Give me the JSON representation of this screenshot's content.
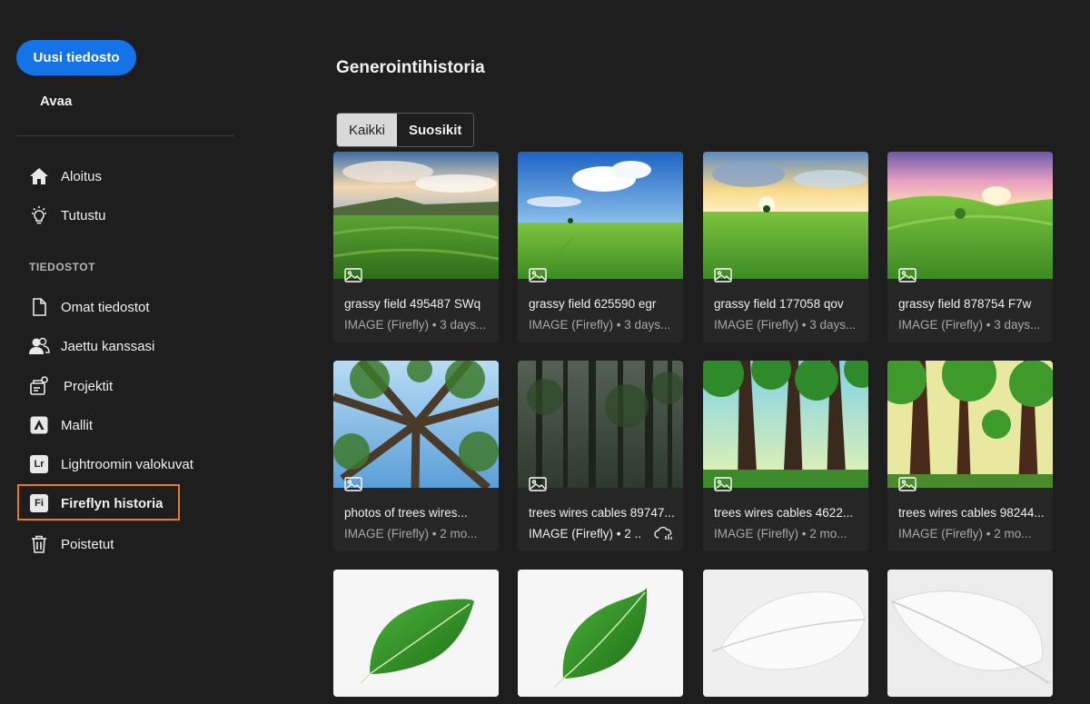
{
  "sidebar": {
    "new_file": "Uusi tiedosto",
    "open": "Avaa",
    "nav_top": [
      {
        "label": "Aloitus",
        "icon": "home-icon"
      },
      {
        "label": "Tutustu",
        "icon": "lightbulb-icon"
      }
    ],
    "section_label": "TIEDOSTOT",
    "nav_files": [
      {
        "label": "Omat tiedostot",
        "icon": "document-icon"
      },
      {
        "label": "Jaettu kanssasi",
        "icon": "people-icon"
      },
      {
        "label": "Projektit",
        "icon": "projects-icon"
      },
      {
        "label": "Mallit",
        "icon": "templates-icon"
      },
      {
        "label": "Lightroomin valokuvat",
        "icon": "lightroom-icon",
        "badge": "Lr"
      },
      {
        "label": "Fireflyn historia",
        "icon": "firefly-icon",
        "badge": "Fi",
        "selected": true
      },
      {
        "label": "Poistetut",
        "icon": "trash-icon"
      }
    ],
    "highlight_color": "#e8782a"
  },
  "main": {
    "title": "Generointihistoria",
    "tabs": [
      {
        "label": "Kaikki",
        "active": true
      },
      {
        "label": "Suosikit",
        "active": false
      }
    ],
    "cards": [
      {
        "title": "grassy field 495487 SWq",
        "meta": "IMAGE (Firefly) • 3 days..."
      },
      {
        "title": "grassy field 625590 egr",
        "meta": "IMAGE (Firefly) • 3 days..."
      },
      {
        "title": "grassy field 177058 qov",
        "meta": "IMAGE (Firefly) • 3 days..."
      },
      {
        "title": "grassy field 878754 F7w",
        "meta": "IMAGE (Firefly) • 3 days..."
      },
      {
        "title": "photos of trees wires...",
        "meta": "IMAGE (Firefly) • 2 mo..."
      },
      {
        "title": "trees wires cables 89747...",
        "meta": "IMAGE (Firefly) • 2 ...",
        "cloud": true
      },
      {
        "title": "trees wires cables 4622...",
        "meta": "IMAGE (Firefly) • 2 mo..."
      },
      {
        "title": "trees wires cables 98244...",
        "meta": "IMAGE (Firefly) • 2 mo..."
      }
    ],
    "accent": "#1473e6"
  }
}
